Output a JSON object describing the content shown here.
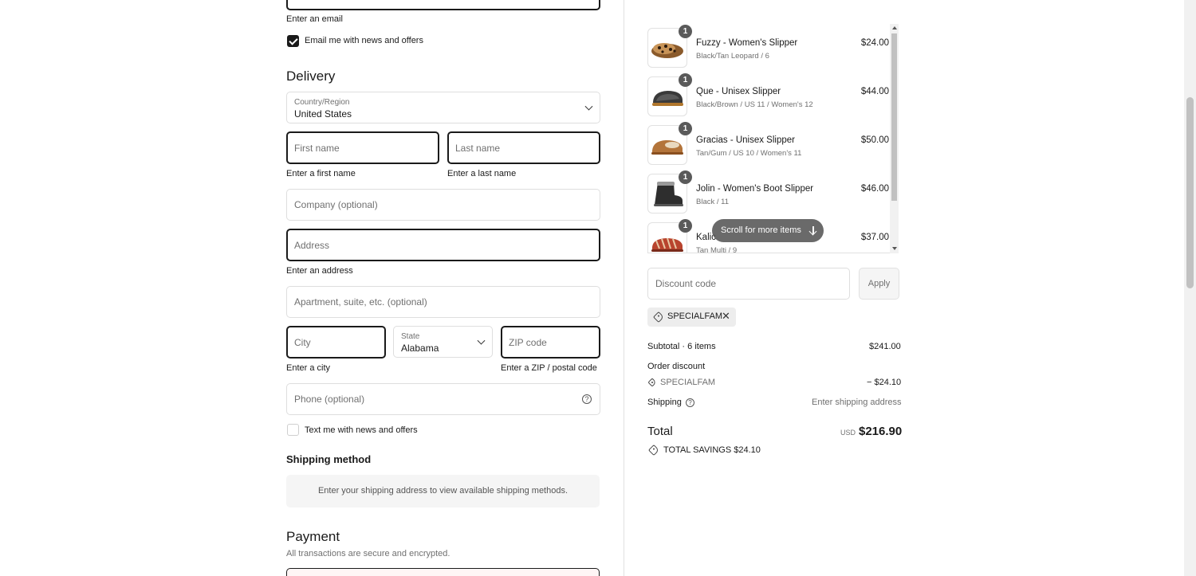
{
  "contact": {
    "email_error": "Enter an email",
    "email_offers_label": "Email me with news and offers"
  },
  "delivery": {
    "heading": "Delivery",
    "country_label": "Country/Region",
    "country_value": "United States",
    "first_name_placeholder": "First name",
    "first_name_error": "Enter a first name",
    "last_name_placeholder": "Last name",
    "last_name_error": "Enter a last name",
    "company_placeholder": "Company (optional)",
    "address_placeholder": "Address",
    "address_error": "Enter an address",
    "apartment_placeholder": "Apartment, suite, etc. (optional)",
    "city_placeholder": "City",
    "city_error": "Enter a city",
    "state_label": "State",
    "state_value": "Alabama",
    "zip_placeholder": "ZIP code",
    "zip_error": "Enter a ZIP / postal code",
    "phone_placeholder": "Phone (optional)",
    "text_offers_label": "Text me with news and offers"
  },
  "shipping": {
    "heading": "Shipping method",
    "message": "Enter your shipping address to view available shipping methods."
  },
  "payment": {
    "heading": "Payment",
    "subtext": "All transactions are secure and encrypted."
  },
  "order": {
    "items": [
      {
        "qty": "1",
        "title": "Fuzzy - Women's Slipper",
        "variant": "Black/Tan Leopard / 6",
        "price": "$24.00"
      },
      {
        "qty": "1",
        "title": "Que - Unisex Slipper",
        "variant": "Black/Brown / US 11 / Women's 12",
        "price": "$44.00"
      },
      {
        "qty": "1",
        "title": "Gracias - Unisex Slipper",
        "variant": "Tan/Gum / US 10 / Women's 11",
        "price": "$50.00"
      },
      {
        "qty": "1",
        "title": "Jolin - Women's Boot Slipper",
        "variant": "Black / 11",
        "price": "$46.00"
      },
      {
        "qty": "1",
        "title": "Kalic",
        "variant": "Tan Multi / 9",
        "price": "$37.00"
      }
    ],
    "scroll_hint": "Scroll for more items",
    "discount_placeholder": "Discount code",
    "apply_label": "Apply",
    "applied_code": "SPECIALFAM",
    "subtotal_label": "Subtotal · 6 items",
    "subtotal_value": "$241.00",
    "order_discount_label": "Order discount",
    "discount_code_line": "SPECIALFAM",
    "discount_value": "− $24.10",
    "shipping_label": "Shipping",
    "shipping_value": "Enter shipping address",
    "total_label": "Total",
    "currency": "USD",
    "total_value": "$216.90",
    "savings_label": "TOTAL SAVINGS  $24.10"
  }
}
